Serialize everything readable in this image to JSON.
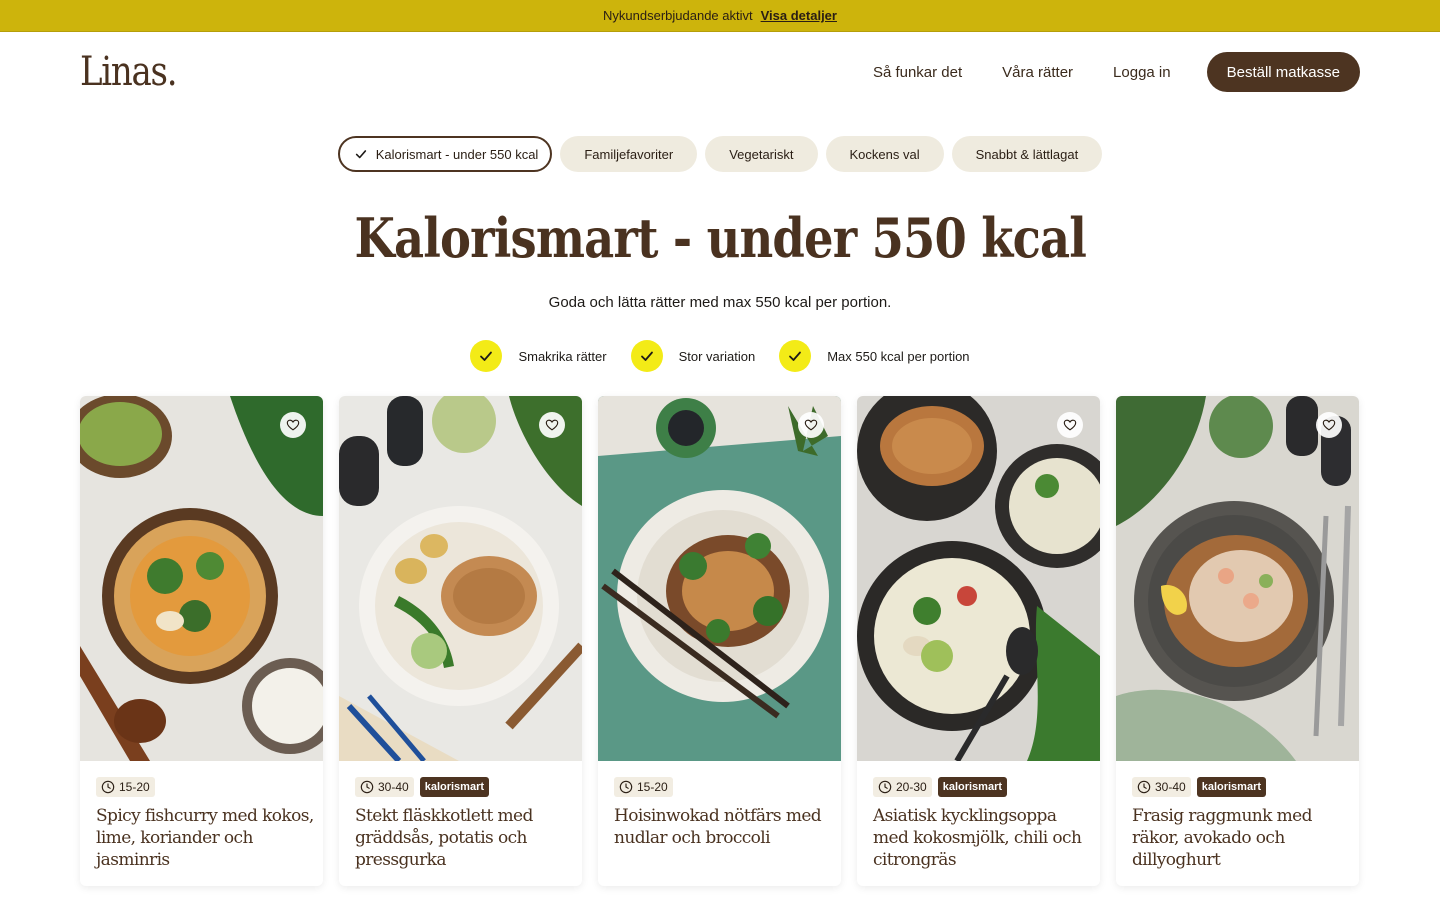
{
  "promo": {
    "text": "Nykundserbjudande aktivt",
    "link": "Visa detaljer"
  },
  "header": {
    "logo": "Linas.",
    "nav": [
      "Så funkar det",
      "Våra rätter",
      "Logga in"
    ],
    "cta": "Beställ matkasse"
  },
  "chips": [
    {
      "label": "Kalorismart - under 550 kcal",
      "active": true
    },
    {
      "label": "Familjefavoriter",
      "active": false
    },
    {
      "label": "Vegetariskt",
      "active": false
    },
    {
      "label": "Kockens val",
      "active": false
    },
    {
      "label": "Snabbt & lättlagat",
      "active": false
    }
  ],
  "hero": {
    "title": "Kalorismart - under 550 kcal",
    "subtitle": "Goda och lätta rätter med max 550 kcal per portion."
  },
  "usps": [
    "Smakrika rätter",
    "Stor variation",
    "Max 550 kcal per portion"
  ],
  "recipes": [
    {
      "time": "15-20",
      "tag": "",
      "title": "Spicy fishcurry med kokos, lime, koriander och jasminris",
      "icon": "fish-curry-photo"
    },
    {
      "time": "30-40",
      "tag": "kalorismart",
      "title": "Stekt fläskkotlett med gräddsås, potatis och pressgurka",
      "icon": "pork-chop-photo"
    },
    {
      "time": "15-20",
      "tag": "",
      "title": "Hoisinwokad nötfärs med nudlar och broccoli",
      "icon": "hoisin-wok-photo"
    },
    {
      "time": "20-30",
      "tag": "kalorismart",
      "title": "Asiatisk kycklingsoppa med kokosmjölk, chili och citrongräs",
      "icon": "chicken-soup-photo"
    },
    {
      "time": "30-40",
      "tag": "kalorismart",
      "title": "Frasig raggmunk med räkor, avokado och dillyoghurt",
      "icon": "raggmunk-photo"
    }
  ],
  "colors": {
    "banner": "#cdb40c",
    "brand": "#4d3421",
    "chip": "#efebdf",
    "check": "#f3eb17"
  }
}
